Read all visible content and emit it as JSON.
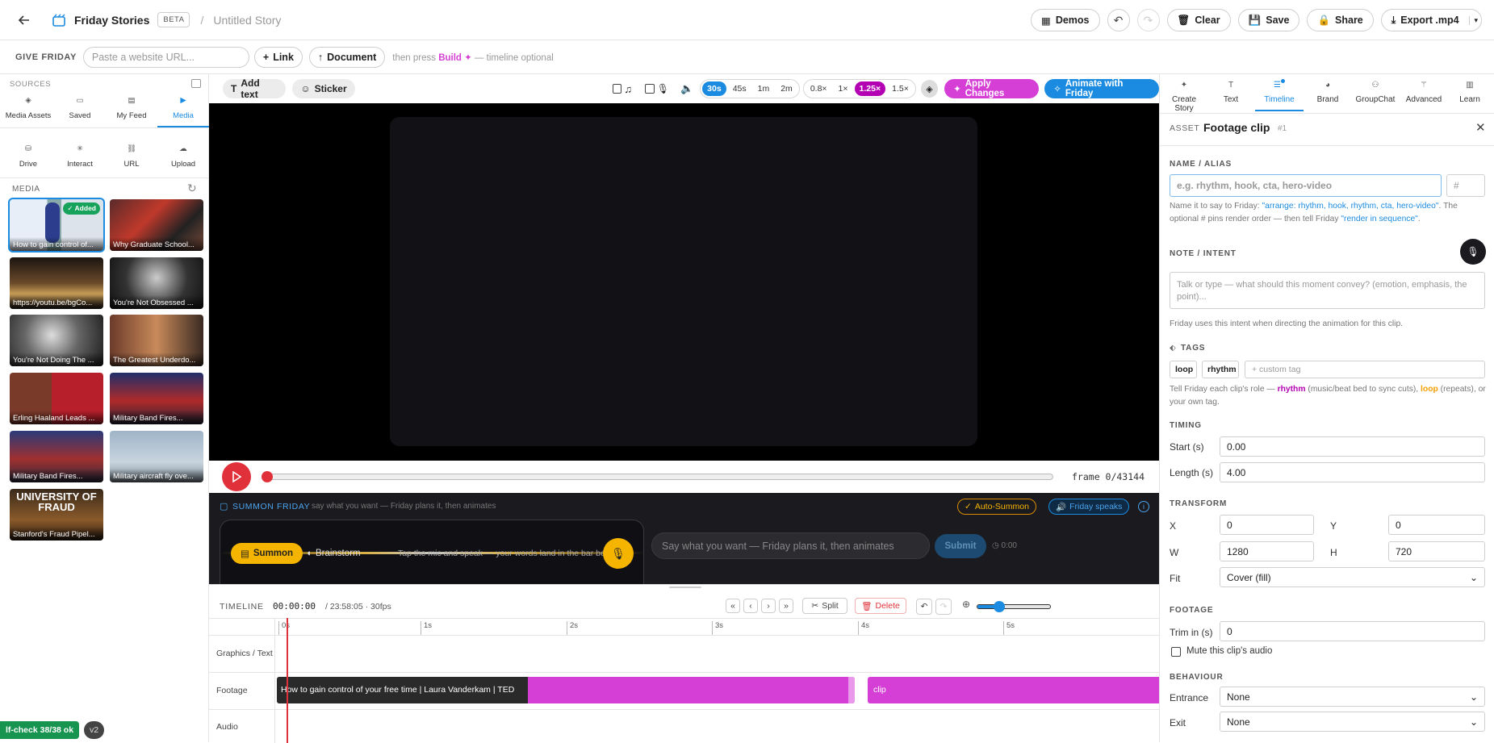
{
  "header": {
    "app_title": "Friday Stories",
    "beta": "BETA",
    "sep": "/",
    "story_title": "Untitled Story",
    "demos": "Demos",
    "clear": "Clear",
    "save": "Save",
    "share": "Share",
    "export": "Export .mp4"
  },
  "give": {
    "label": "GIVE FRIDAY",
    "placeholder": "Paste a website URL...",
    "link": "Link",
    "document": "Document",
    "hint_pre": "then press",
    "hint_build": "Build ✦",
    "hint_post": "— timeline optional"
  },
  "sources": {
    "label": "SOURCES",
    "tabs": [
      "Media Assets",
      "Saved",
      "My Feed",
      "Media"
    ],
    "actions": [
      "Drive",
      "Interact",
      "URL",
      "Upload"
    ],
    "media_label": "MEDIA",
    "added": "✓ Added",
    "items": [
      "How to gain control of...",
      "Why Graduate School...",
      "https://youtu.be/bgCo...",
      "You're Not Obsessed ...",
      "You're Not Doing The ...",
      "The Greatest Underdo...",
      "Erling Haaland Leads ...",
      "Military Band Fires...",
      "Military Band Fires...",
      "Military aircraft fly ove...",
      "Stanford's Fraud Pipel..."
    ],
    "fraud_text": "UNIVERSITY OF FRAUD"
  },
  "toolbar": {
    "add_text": "Add text",
    "sticker": "Sticker",
    "durations": [
      "30s",
      "45s",
      "1m",
      "2m"
    ],
    "speeds": [
      "0.8×",
      "1×",
      "1.25×",
      "1.5×"
    ],
    "apply": "Apply Changes",
    "animate": "Animate with Friday"
  },
  "player": {
    "frame": "frame 0/43144"
  },
  "summon": {
    "title": "SUMMON FRIDAY",
    "sub": "say what you want — Friday plans it, then animates",
    "auto": "Auto-Summon",
    "speaks": "Friday speaks",
    "summon_btn": "Summon",
    "brainstorm": "Brainstorm",
    "tap_hint": "Tap the mic and speak — your words land in the bar below",
    "placeholder": "Say what you want — Friday plans it, then animates",
    "submit": "Submit",
    "time": "0:00"
  },
  "timeline": {
    "label": "TIMELINE",
    "time": "00:00:00",
    "total": "/ 23:58:05 · 30fps",
    "split": "Split",
    "delete": "Delete",
    "ticks": [
      "0s",
      "1s",
      "2s",
      "3s",
      "4s",
      "5s"
    ],
    "tracks": [
      "Graphics / Text",
      "Footage",
      "Audio"
    ],
    "clip1": "How to gain control of your free time | Laura Vanderkam | TED",
    "clip2": "clip",
    "zoom_level": 0.3
  },
  "panel": {
    "tabs": [
      "Create Story",
      "Text",
      "Timeline",
      "Brand",
      "GroupChat",
      "Advanced",
      "Learn"
    ],
    "asset": "ASSET",
    "title": "Footage clip",
    "num": "#1",
    "name_label": "NAME / ALIAS",
    "name_ph": "e.g. rhythm, hook, cta, hero-video",
    "hash_ph": "#",
    "name_help_a": "Name it to say to Friday:",
    "name_help_b": "\"arrange: rhythm, hook, rhythm, cta, hero-video\"",
    "name_help_c": ". The optional # pins render order — then tell Friday",
    "name_help_d": "\"render in sequence\"",
    "name_help_e": ".",
    "note_label": "NOTE / INTENT",
    "note_ph": "Talk or type — what should this moment convey? (emotion, emphasis, the point)...",
    "note_help": "Friday uses this intent when directing the animation for this clip.",
    "tags_label": "TAGS",
    "tags": [
      "loop",
      "rhythm"
    ],
    "tag_ph": "+ custom tag",
    "tags_help_a": "Tell Friday each clip's role —",
    "tags_help_b": "rhythm",
    "tags_help_c": "(music/beat bed to sync cuts),",
    "tags_help_d": "loop",
    "tags_help_e": "(repeats), or your own tag.",
    "timing_label": "TIMING",
    "start_l": "Start (s)",
    "start": "0.00",
    "length_l": "Length (s)",
    "length": "4.00",
    "transform_label": "TRANSFORM",
    "x_l": "X",
    "x": "0",
    "y_l": "Y",
    "y": "0",
    "w_l": "W",
    "w": "1280",
    "h_l": "H",
    "h": "720",
    "fit_l": "Fit",
    "fit": "Cover (fill)",
    "footage_label": "FOOTAGE",
    "trim_l": "Trim in (s)",
    "trim": "0",
    "mute": "Mute this clip's audio",
    "behaviour_label": "BEHAVIOUR",
    "entrance_l": "Entrance",
    "entrance": "None",
    "exit_l": "Exit",
    "exit": "None"
  },
  "footer": {
    "check": "lf-check 38/38 ok",
    "ver": "v2"
  },
  "colors": {
    "accent": "#1a8be0",
    "magenta": "#d63fd6",
    "amber": "#f5b400",
    "red": "#e0303a"
  }
}
